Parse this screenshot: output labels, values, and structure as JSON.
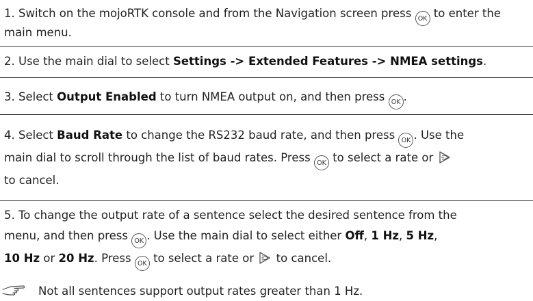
{
  "steps": [
    {
      "number": "1.",
      "a": "Switch on the mojoRTK console and from the Navigation screen press",
      "b": "to enter the main menu."
    },
    {
      "number": "2.",
      "a": "Use the main dial to select",
      "bold": "Settings -> Extended Features -> NMEA settings",
      "b": "."
    },
    {
      "number": "3.",
      "a": "Select",
      "bold": "Output Enabled",
      "b": "to turn NMEA output on, and then press",
      "c": "."
    },
    {
      "number": "4.",
      "a": "Select",
      "bold": "Baud Rate",
      "b": "to change the RS232 baud rate, and then press",
      "c": ". Use the",
      "d": "main dial to scroll through the list of baud rates. Press",
      "e": "to select a rate or",
      "f": "to cancel."
    },
    {
      "number": "5.",
      "a": "To change the output rate of a sentence select the desired sentence from the",
      "b": "menu, and then press",
      "c": ". Use the main dial to select either",
      "opt1": "Off",
      "opt2": "1 Hz",
      "opt3": "5 Hz",
      "opt4": "10 Hz",
      "or": "or",
      "opt5": "20 Hz",
      "d": ". Press",
      "e": "to select a rate or",
      "f": "to cancel."
    }
  ],
  "ok_label": "OK",
  "note": {
    "icon": "pointing-hand-icon",
    "text": "Not all sentences support output rates greater than 1 Hz."
  }
}
